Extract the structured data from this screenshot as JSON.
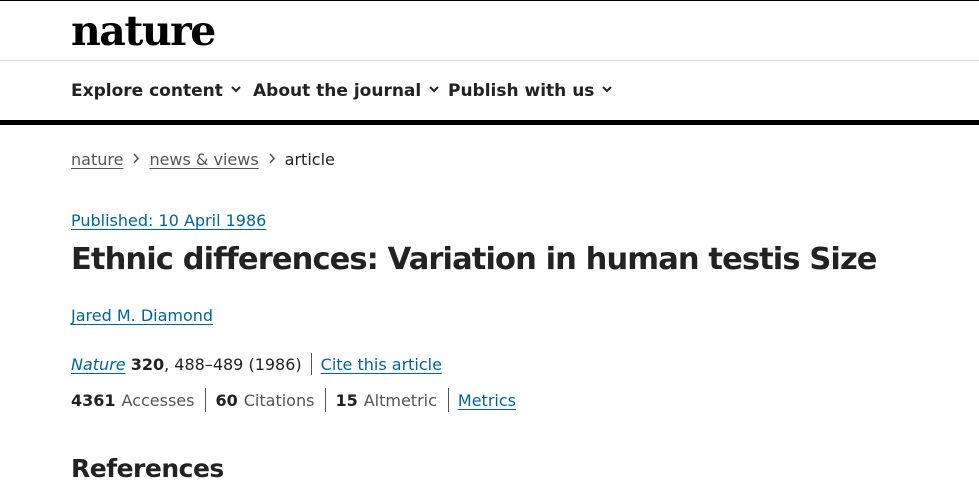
{
  "header": {
    "logo_text": "nature"
  },
  "nav": {
    "items": [
      {
        "label": "Explore content"
      },
      {
        "label": "About the journal"
      },
      {
        "label": "Publish with us"
      }
    ]
  },
  "breadcrumb": {
    "items": [
      "nature",
      "news & views"
    ],
    "current": "article"
  },
  "article": {
    "published": "Published: 10 April 1986",
    "title": "Ethnic differences: Variation in human testis Size",
    "author": "Jared M. Diamond",
    "citation": {
      "journal": "Nature",
      "volume": "320",
      "pages": ", 488–489 (1986)",
      "cite_label": "Cite this article"
    },
    "metrics": {
      "accesses_value": "4361",
      "accesses_label": "Accesses",
      "citations_value": "60",
      "citations_label": "Citations",
      "altmetric_value": "15",
      "altmetric_label": "Altmetric",
      "metrics_link": "Metrics"
    }
  },
  "section": {
    "references_heading": "References"
  },
  "colors": {
    "link": "#006699",
    "text": "#222222",
    "muted": "#555555"
  }
}
